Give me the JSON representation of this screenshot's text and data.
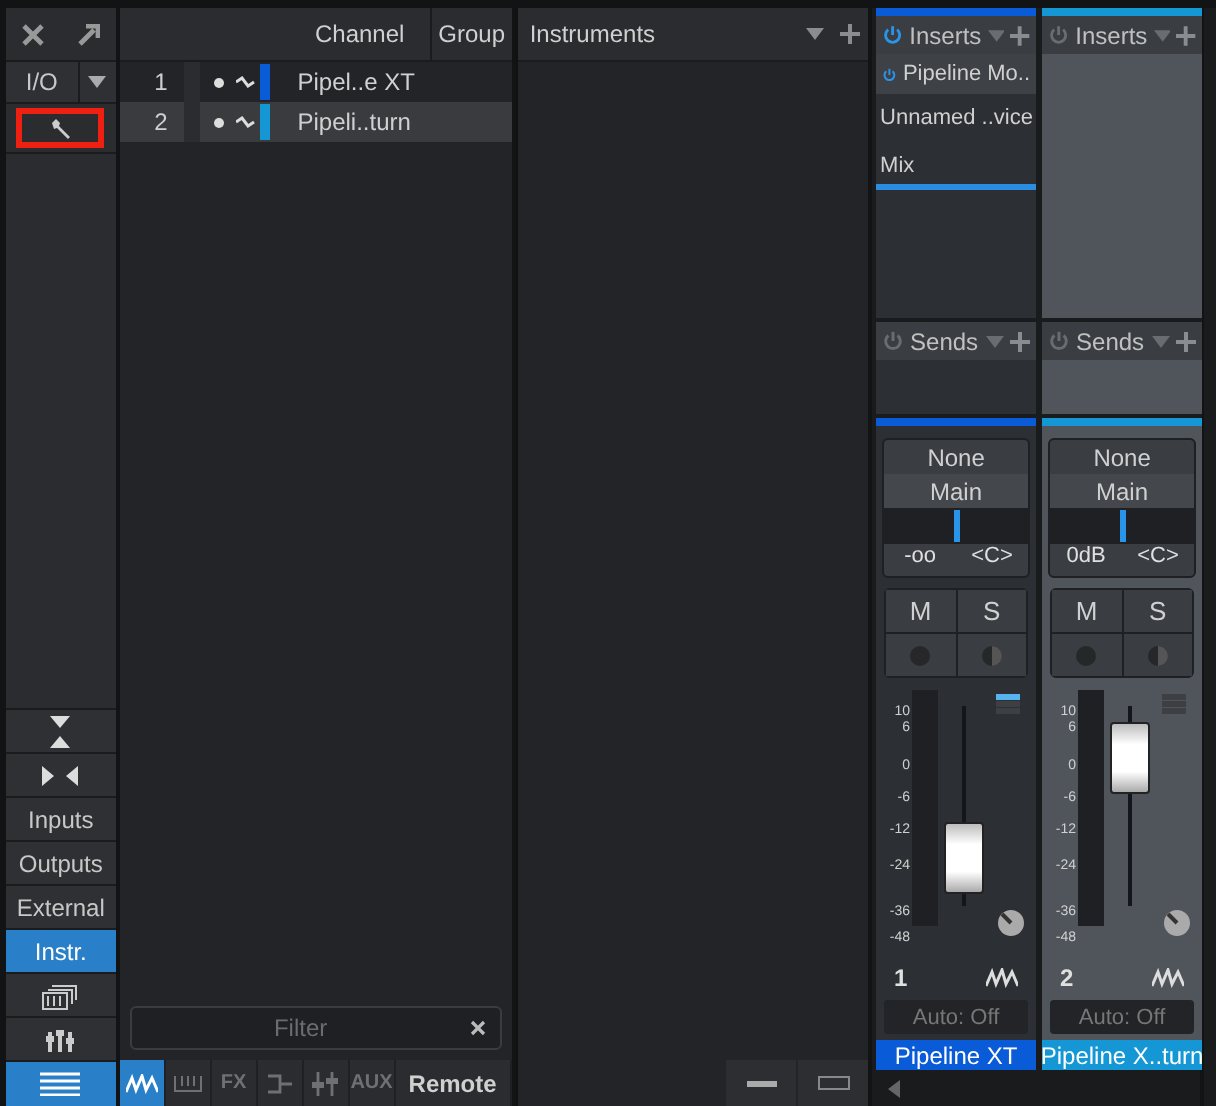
{
  "sidebar": {
    "io_label": "I/O",
    "wrench_highlighted": true,
    "buttons": [
      {
        "kind": "icon",
        "selected": false
      },
      {
        "kind": "icon",
        "selected": false
      },
      {
        "kind": "text",
        "label": "Inputs",
        "selected": false
      },
      {
        "kind": "text",
        "label": "Outputs",
        "selected": false
      },
      {
        "kind": "text",
        "label": "External",
        "selected": false
      },
      {
        "kind": "text",
        "label": "Instr.",
        "selected": true
      },
      {
        "kind": "icon",
        "selected": false
      },
      {
        "kind": "icon",
        "selected": false
      },
      {
        "kind": "icon",
        "selected": true
      }
    ]
  },
  "channel_list": {
    "columns": [
      "Channel",
      "Group"
    ],
    "rows": [
      {
        "number": "1",
        "name": "Pipel..e XT",
        "color": "#0a5bd8",
        "selected": false
      },
      {
        "number": "2",
        "name": "Pipeli..turn",
        "color": "#1497d4",
        "selected": true
      }
    ],
    "filter": {
      "placeholder": "Filter"
    },
    "tabs": [
      {
        "kind": "icon",
        "selected": true
      },
      {
        "kind": "icon",
        "selected": false
      },
      {
        "kind": "text",
        "label": "FX",
        "selected": false
      },
      {
        "kind": "icon",
        "selected": false
      },
      {
        "kind": "icon",
        "selected": false
      },
      {
        "kind": "text",
        "label": "AUX",
        "selected": false
      },
      {
        "kind": "text",
        "label": "Remote",
        "selected": false
      }
    ]
  },
  "instruments": {
    "title": "Instruments"
  },
  "mixer": {
    "strips": [
      {
        "name": "Pipeline XT",
        "number": "1",
        "color": "#0a5bd8",
        "selected": false,
        "inserts_label": "Inserts",
        "inserts_on": true,
        "inserts": [
          {
            "kind": "plugin",
            "label": "Pipeline Mo..",
            "on": true
          },
          {
            "kind": "text",
            "label": "Unnamed ..vice"
          },
          {
            "kind": "text",
            "label": "Mix"
          }
        ],
        "sends_label": "Sends",
        "routing": [
          "None",
          "Main"
        ],
        "volume": "-oo",
        "pan": {
          "reading": "<C>",
          "level": 0.5
        },
        "mute": "M",
        "solo": "S",
        "level": 0.2,
        "automation": "Auto: Off",
        "scale": [
          "10",
          "6",
          "0",
          "-6",
          "-12",
          "-24",
          "-36",
          "-48"
        ]
      },
      {
        "name": "Pipeline X..turn",
        "number": "2",
        "color": "#1497d4",
        "selected": true,
        "inserts_label": "Inserts",
        "inserts_on": false,
        "sends_label": "Sends",
        "routing": [
          "None",
          "Main"
        ],
        "volume": "0dB",
        "pan": {
          "reading": "<C>",
          "level": 0.5
        },
        "mute": "M",
        "solo": "S",
        "level": 0.8,
        "automation": "Auto: Off",
        "scale": [
          "10",
          "6",
          "0",
          "-6",
          "-12",
          "-24",
          "-36",
          "-48"
        ]
      }
    ]
  }
}
